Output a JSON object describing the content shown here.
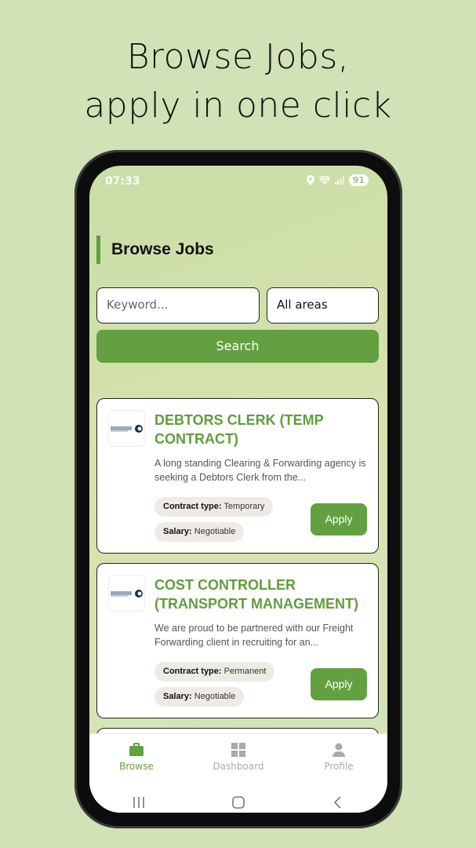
{
  "headline": {
    "line1": "Browse Jobs,",
    "line2": "apply in one click"
  },
  "status_bar": {
    "time": "07:33",
    "battery": "91"
  },
  "page": {
    "title": "Browse Jobs"
  },
  "search": {
    "keyword_placeholder": "Keyword...",
    "area_value": "All areas",
    "button_label": "Search"
  },
  "jobs": [
    {
      "title": "DEBTORS CLERK (TEMP CONTRACT)",
      "description": "A long standing Clearing & Forwarding agency is seeking a Debtors Clerk from the...",
      "contract_label": "Contract type:",
      "contract_value": "Temporary",
      "salary_label": "Salary:",
      "salary_value": "Negotiable",
      "apply_label": "Apply"
    },
    {
      "title": "COST CONTROLLER (TRANSPORT MANAGEMENT)",
      "description": "We are proud to be partnered with our Freight Forwarding client in recruiting for an...",
      "contract_label": "Contract type:",
      "contract_value": "Permanent",
      "salary_label": "Salary:",
      "salary_value": "Negotiable",
      "apply_label": "Apply"
    }
  ],
  "bottom_nav": {
    "items": [
      {
        "label": "Browse",
        "icon": "briefcase-icon",
        "active": true
      },
      {
        "label": "Dashboard",
        "icon": "grid-icon",
        "active": false
      },
      {
        "label": "Profile",
        "icon": "person-icon",
        "active": false
      }
    ]
  },
  "colors": {
    "background": "#d0e2b6",
    "accent": "#63a042",
    "title_green": "#5f9e3c"
  }
}
